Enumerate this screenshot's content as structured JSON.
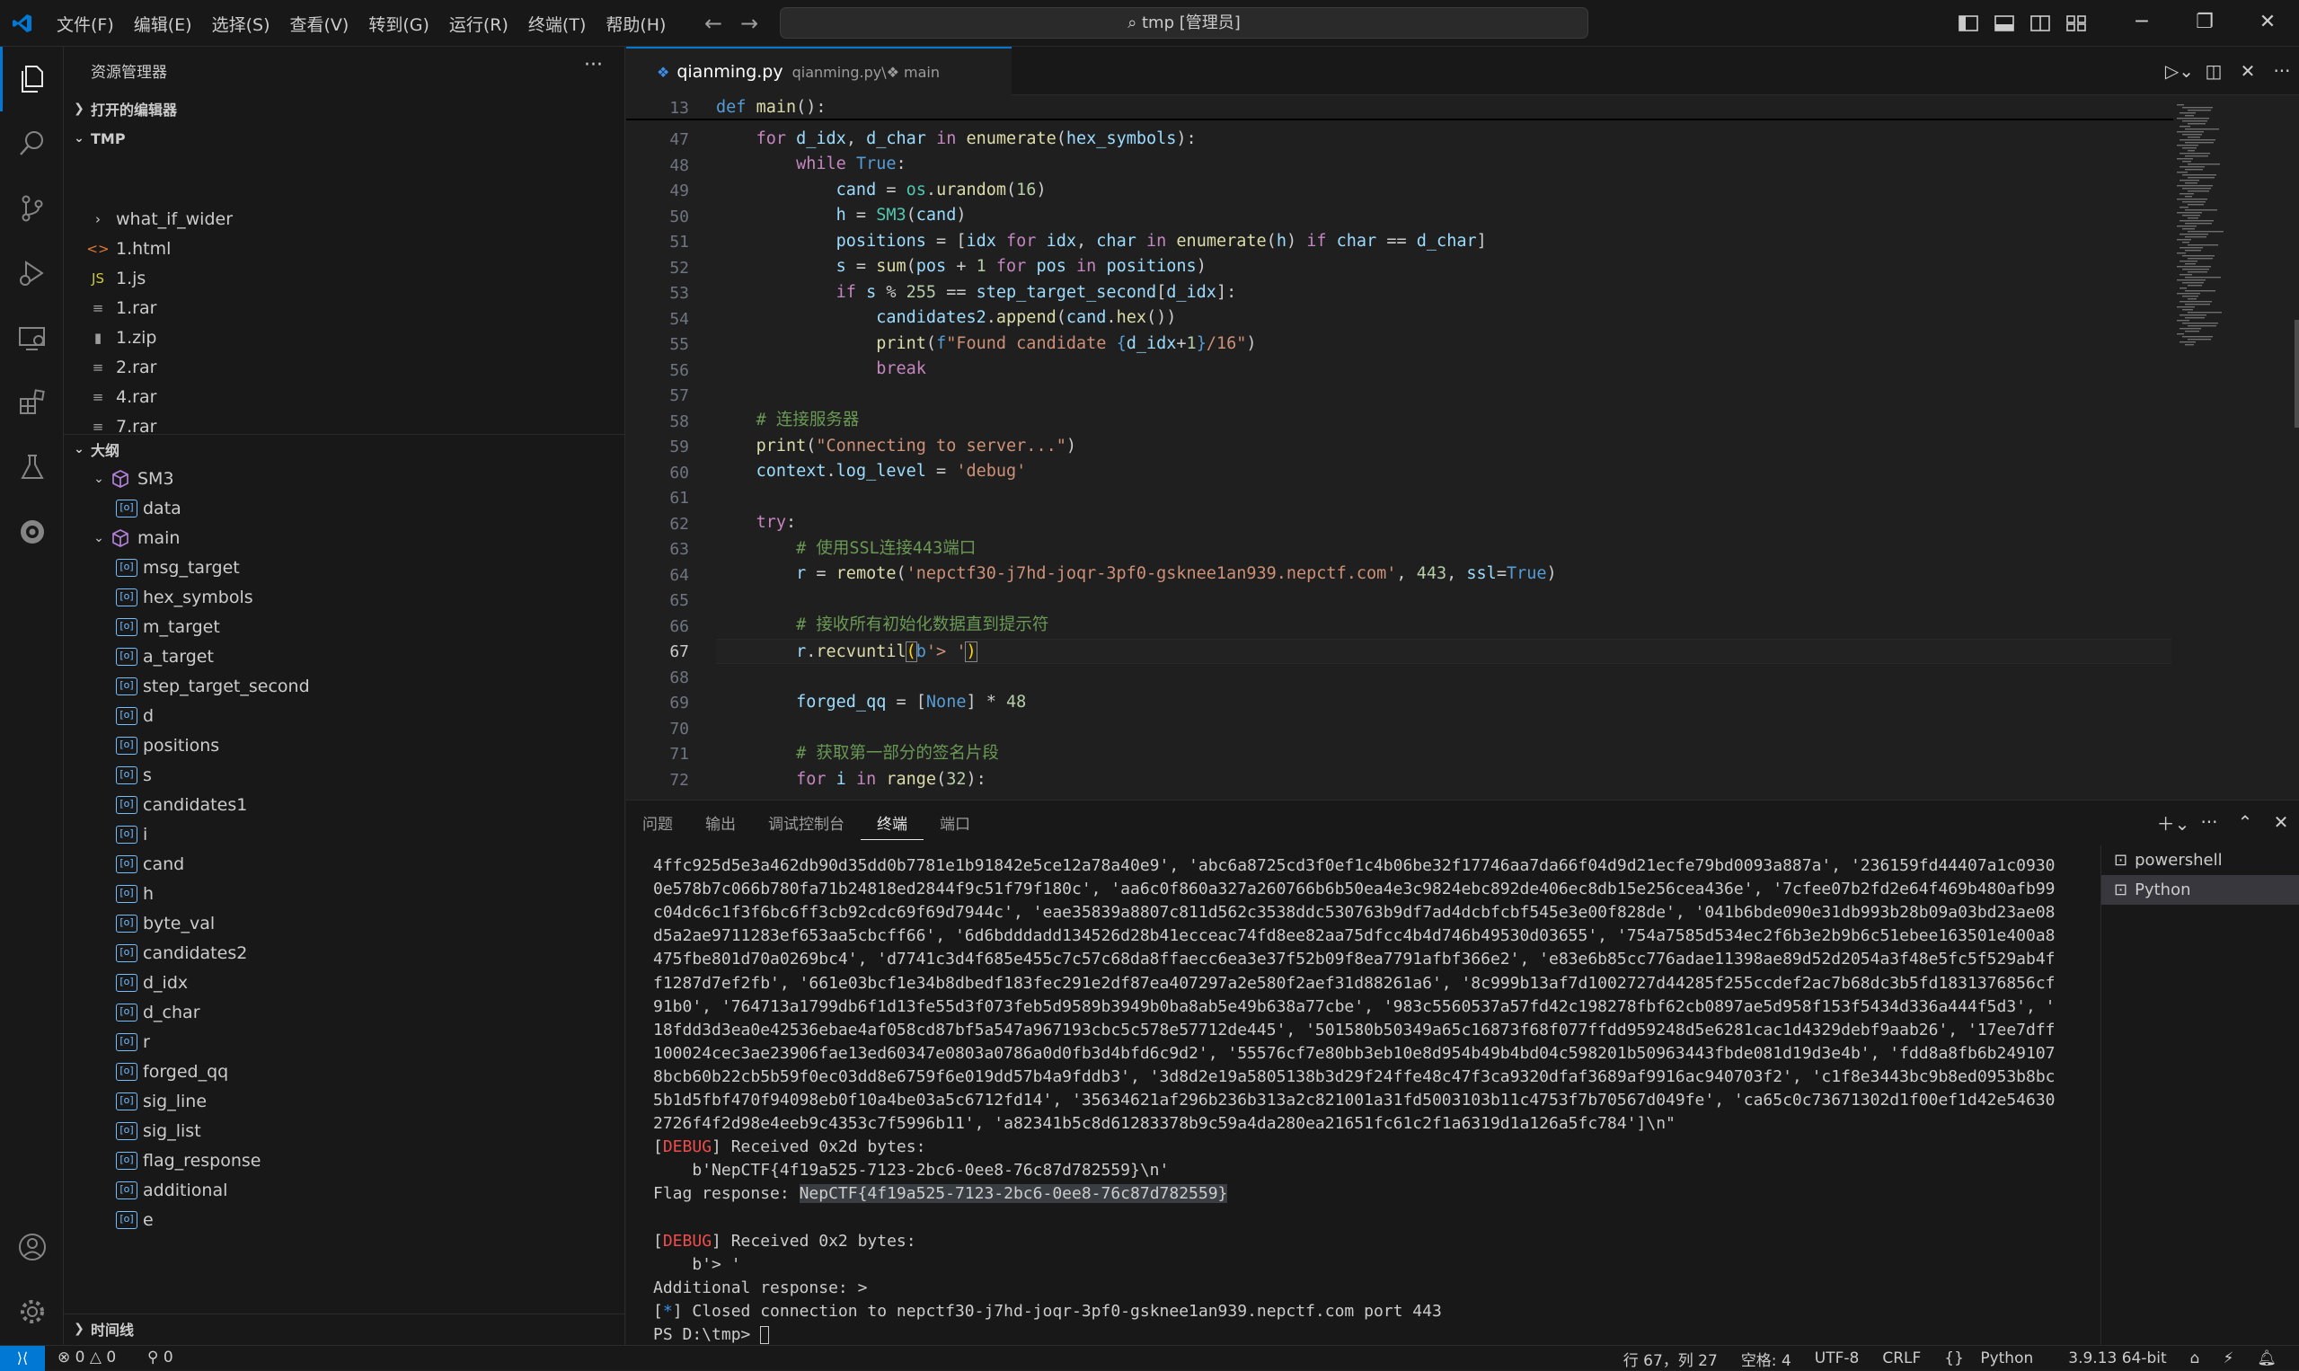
{
  "menu": {
    "items": [
      "文件(F)",
      "编辑(E)",
      "选择(S)",
      "查看(V)",
      "转到(G)",
      "运行(R)",
      "终端(T)",
      "帮助(H)"
    ]
  },
  "title": {
    "search": "tmp [管理员]"
  },
  "sidebar": {
    "title": "资源管理器",
    "more": "···",
    "open_editors": "打开的编辑器",
    "folder": "TMP",
    "files": [
      {
        "name": "what_if_wider",
        "icon": "›"
      },
      {
        "name": "1.html",
        "icon": "<>"
      },
      {
        "name": "1.js",
        "icon": "JS"
      },
      {
        "name": "1.rar",
        "icon": "≡"
      },
      {
        "name": "1.zip",
        "icon": "▮"
      },
      {
        "name": "2.rar",
        "icon": "≡"
      },
      {
        "name": "4.rar",
        "icon": "≡"
      },
      {
        "name": "7.rar",
        "icon": "≡"
      }
    ],
    "outline": "大纲",
    "outline_items": [
      {
        "name": "SM3",
        "kind": "class"
      },
      {
        "name": "data",
        "kind": "var"
      },
      {
        "name": "main",
        "kind": "class"
      },
      {
        "name": "msg_target",
        "kind": "var"
      },
      {
        "name": "hex_symbols",
        "kind": "var"
      },
      {
        "name": "m_target",
        "kind": "var"
      },
      {
        "name": "a_target",
        "kind": "var"
      },
      {
        "name": "step_target_second",
        "kind": "var"
      },
      {
        "name": "d",
        "kind": "var"
      },
      {
        "name": "positions",
        "kind": "var"
      },
      {
        "name": "s",
        "kind": "var"
      },
      {
        "name": "candidates1",
        "kind": "var"
      },
      {
        "name": "i",
        "kind": "var"
      },
      {
        "name": "cand",
        "kind": "var"
      },
      {
        "name": "h",
        "kind": "var"
      },
      {
        "name": "byte_val",
        "kind": "var"
      },
      {
        "name": "candidates2",
        "kind": "var"
      },
      {
        "name": "d_idx",
        "kind": "var"
      },
      {
        "name": "d_char",
        "kind": "var"
      },
      {
        "name": "r",
        "kind": "var"
      },
      {
        "name": "forged_qq",
        "kind": "var"
      },
      {
        "name": "sig_line",
        "kind": "var"
      },
      {
        "name": "sig_list",
        "kind": "var"
      },
      {
        "name": "flag_response",
        "kind": "var"
      },
      {
        "name": "additional",
        "kind": "var"
      },
      {
        "name": "e",
        "kind": "var"
      }
    ],
    "timeline": "时间线"
  },
  "editor": {
    "tab_name": "qianming.py",
    "breadcrumb_file": "qianming.py",
    "breadcrumb_sep": "\\",
    "breadcrumb_symbol": "main",
    "sticky_line": "13",
    "sticky_text": "def main():",
    "current_line": "67",
    "line_numbers": [
      "47",
      "48",
      "49",
      "50",
      "51",
      "52",
      "53",
      "54",
      "55",
      "56",
      "57",
      "58",
      "59",
      "60",
      "61",
      "62",
      "63",
      "64",
      "65",
      "66",
      "67",
      "68",
      "69",
      "70",
      "71",
      "72"
    ]
  },
  "panel": {
    "tabs": [
      "问题",
      "输出",
      "调试控制台",
      "终端",
      "端口"
    ],
    "active_tab": "终端",
    "terminals": [
      "powershell",
      "Python"
    ],
    "output_lines": [
      "4ffc925d5e3a462db90d35dd0b7781e1b91842e5ce12a78a40e9', 'abc6a8725cd3f0ef1c4b06be32f17746aa7da66f04d9d21ecfe79bd0093a887a', '236159fd44407a1c0930",
      "0e578b7c066b780fa71b24818ed2844f9c51f79f180c', 'aa6c0f860a327a260766b6b50ea4e3c9824ebc892de406ec8db15e256cea436e', '7cfee07b2fd2e64f469b480afb99",
      "c04dc6c1f3f6bc6ff3cb92cdc69f69d7944c', 'eae35839a8807c811d562c3538ddc530763b9df7ad4dcbfcbf545e3e00f828de', '041b6bde090e31db993b28b09a03bd23ae08",
      "d5a2ae9711283ef653aa5cbcff66', '6d6bdddadd134526d28b41ecceac74fd8ee82aa75dfcc4b4d746b49530d03655', '754a7585d534ec2f6b3e2b9b6c51ebee163501e400a8",
      "475fbe801d70a0269bc4', 'd7741c3d4f685e455c7c57c68da8ffaecc6ea3e37f52b09f8ea7791afbf366e2', 'e83e6b85cc776adae11398ae89d52d2054a3f48e5fc5f529ab4f",
      "f1287d7ef2fb', '661e03bcf1e34b8dbedf183fec291e2df87ea407297a2e580f2aef31d88261a6', '8c999b13af7d1002727d44285f255ccdef2ac7b68dc3b5fd1831376856cf",
      "91b0', '764713a1799db6f1d13fe55d3f073feb5d9589b3949b0ba8ab5e49b638a77cbe', '983c5560537a57fd42c198278fbf62cb0897ae5d958f153f5434d336a444f5d3', '",
      "18fdd3d3ea0e42536ebae4af058cd87bf5a547a967193cbc5c578e57712de445', '501580b50349a65c16873f68f077ffdd959248d5e6281cac1d4329debf9aab26', '17ee7dff",
      "100024cec3ae23906fae13ed60347e0803a0786a0d0fb3d4bfd6c9d2', '55576cf7e80bb3eb10e8d954b49b4bd04c598201b50963443fbde081d19d3e4b', 'fdd8a8fb6b249107",
      "8bcb60b22cb5b59f0ec03dd8e6759f6e019dd57b4a9fddb3', '3d8d2e19a5805138b3d29f24ffe48c47f3ca9320dfaf3689af9916ac940703f2', 'c1f8e3443bc9b8ed0953b8bc",
      "5b1d5fbf470f94098eb0f10a4be03a5c6712fd14', '35634621af296b236b313a2c821001a31fd5003103b11c4753f7b70567d049fe', 'ca65c0c73671302d1f00ef1d42e54630",
      "2726f4f2d98e4eeb9c4353c7f5996b11', 'a82341b5c8d61283378b9c59a4da280ea21651fc61c2f1a6319d1a126a5fc784']\\n\""
    ],
    "debug_tag": "DEBUG",
    "recv1": "] Received 0x2d bytes:",
    "recv1_body": "    b'NepCTF{4f19a525-7123-2bc6-0ee8-76c87d782559}\\n'",
    "flag_label": "Flag response: ",
    "flag_value": "NepCTF{4f19a525-7123-2bc6-0ee8-76c87d782559}",
    "recv2": "] Received 0x2 bytes:",
    "recv2_body": "    b'> '",
    "additional": "Additional response: >",
    "closed_tag": "*",
    "closed": "] Closed connection to nepctf30-j7hd-joqr-3pf0-gsknee1an939.nepctf.com port 443",
    "prompt": "PS D:\\tmp> "
  },
  "statusbar": {
    "errors": "0",
    "warnings": "0",
    "ports": "0",
    "position": "行 67，列 27",
    "spaces": "空格: 4",
    "encoding": "UTF-8",
    "eol": "CRLF",
    "language": "Python",
    "interpreter": "3.9.13 64-bit"
  },
  "colors": {
    "accent": "#0078d4",
    "debug": "#f14c4c",
    "keyword": "#c586c0",
    "string": "#ce9178",
    "comment": "#6a9955"
  }
}
